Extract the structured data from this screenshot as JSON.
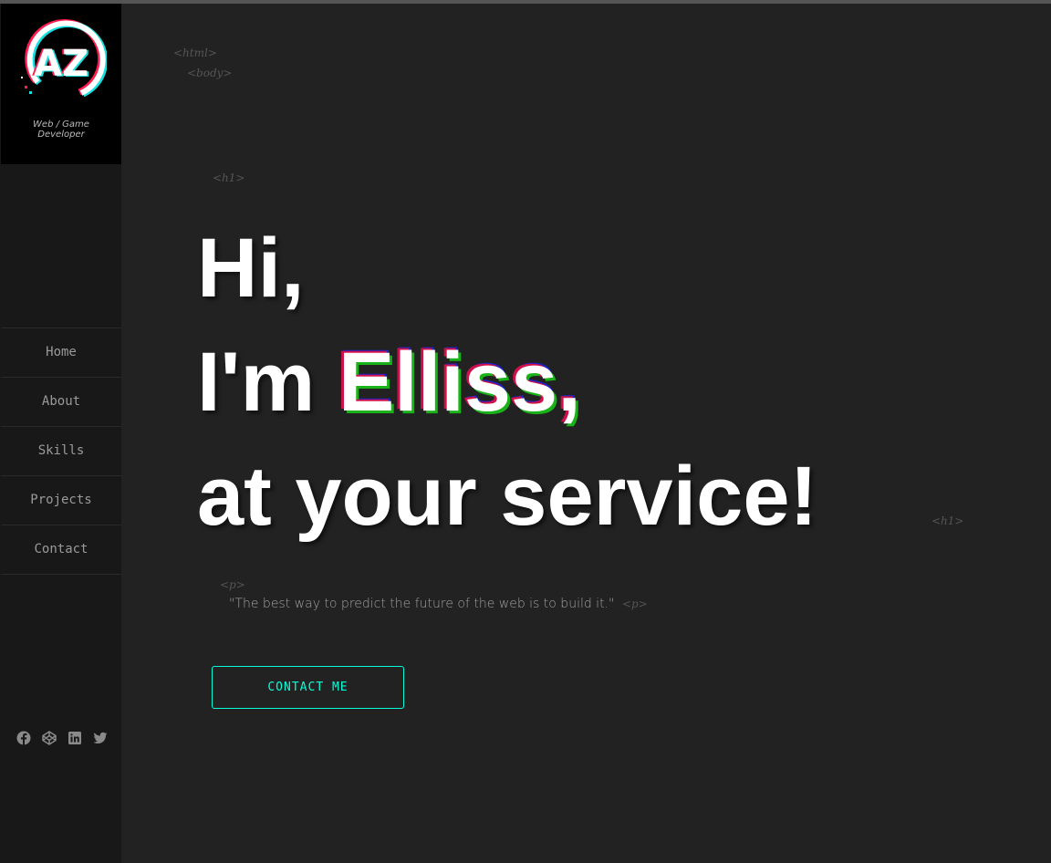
{
  "logo": {
    "text": "AZ",
    "subtitle_line1": "Web / Game",
    "subtitle_line2": "Developer"
  },
  "nav": {
    "items": [
      {
        "label": "Home"
      },
      {
        "label": "About"
      },
      {
        "label": "Skills"
      },
      {
        "label": "Projects"
      },
      {
        "label": "Contact"
      }
    ]
  },
  "socials": [
    "facebook-icon",
    "codepen-icon",
    "linkedin-icon",
    "twitter-icon"
  ],
  "tags": {
    "html_open": "<html>",
    "body_open": "<body>",
    "h1_open": "<h1>",
    "h1_close": "<h1>",
    "p_open": "<p>",
    "p_close": "<p>"
  },
  "hero": {
    "line1": "Hi,",
    "line2_prefix": "I'm ",
    "name": "Elliss,",
    "line3": "at your service!"
  },
  "quote": "\"The best way to predict the future of the web is to build it.\"",
  "cta": {
    "label": "CONTACT ME"
  },
  "colors": {
    "accent": "#08fdd8",
    "glitch_red": "#d0104a",
    "glitch_green": "#19b319",
    "background": "#222222",
    "sidebar": "#181818"
  }
}
